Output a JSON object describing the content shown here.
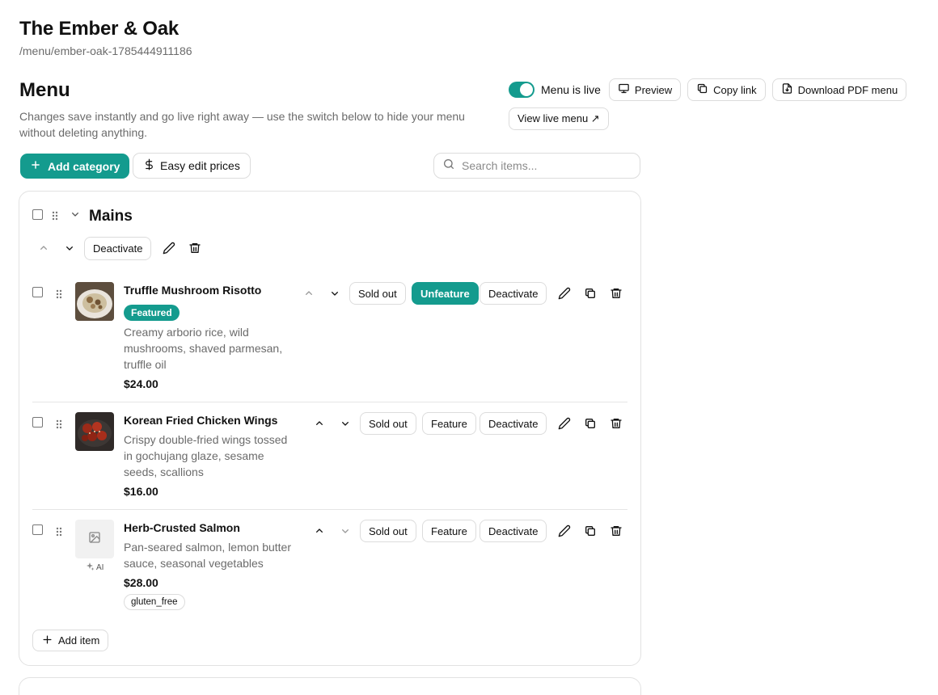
{
  "restaurant": {
    "name": "The Ember & Oak",
    "slug": "/menu/ember-oak-1785444911186"
  },
  "menu": {
    "heading": "Menu",
    "description": "Changes save instantly and go live right away — use the switch below to hide your menu without deleting anything."
  },
  "top_actions": {
    "live_label": "Menu is live",
    "live_on": true,
    "preview": "Preview",
    "copy_link": "Copy link",
    "download_pdf": "Download PDF menu",
    "view_live": "View live menu ↗"
  },
  "toolbar": {
    "add_category": "Add category",
    "easy_edit": "Easy edit prices",
    "search_placeholder": "Search items..."
  },
  "category": {
    "name": "Mains",
    "deactivate": "Deactivate",
    "add_item": "Add item",
    "items": [
      {
        "name": "Truffle Mushroom Risotto",
        "featured_badge": "Featured",
        "desc_lines": [
          "Creamy arborio rice, wild",
          "mushrooms, shaved parmesan,",
          "truffle oil"
        ],
        "price": "$24.00",
        "sold_out": "Sold out",
        "feature_toggle": "Unfeature",
        "deactivate": "Deactivate"
      },
      {
        "name": "Korean Fried Chicken Wings",
        "desc_lines": [
          "Crispy double-fried wings tossed",
          "in gochujang glaze, sesame",
          "seeds, scallions"
        ],
        "price": "$16.00",
        "sold_out": "Sold out",
        "feature_toggle": "Feature",
        "deactivate": "Deactivate"
      },
      {
        "name": "Herb-Crusted Salmon",
        "desc_lines": [
          "Pan-seared salmon, lemon butter",
          "sauce, seasonal vegetables"
        ],
        "price": "$28.00",
        "sold_out": "Sold out",
        "feature_toggle": "Feature",
        "deactivate": "Deactivate",
        "ai_label": "AI",
        "tag": "gluten_free"
      }
    ]
  },
  "colors": {
    "accent": "#149b8e",
    "border": "#dcdcdc",
    "muted_text": "#6b6b6b"
  }
}
